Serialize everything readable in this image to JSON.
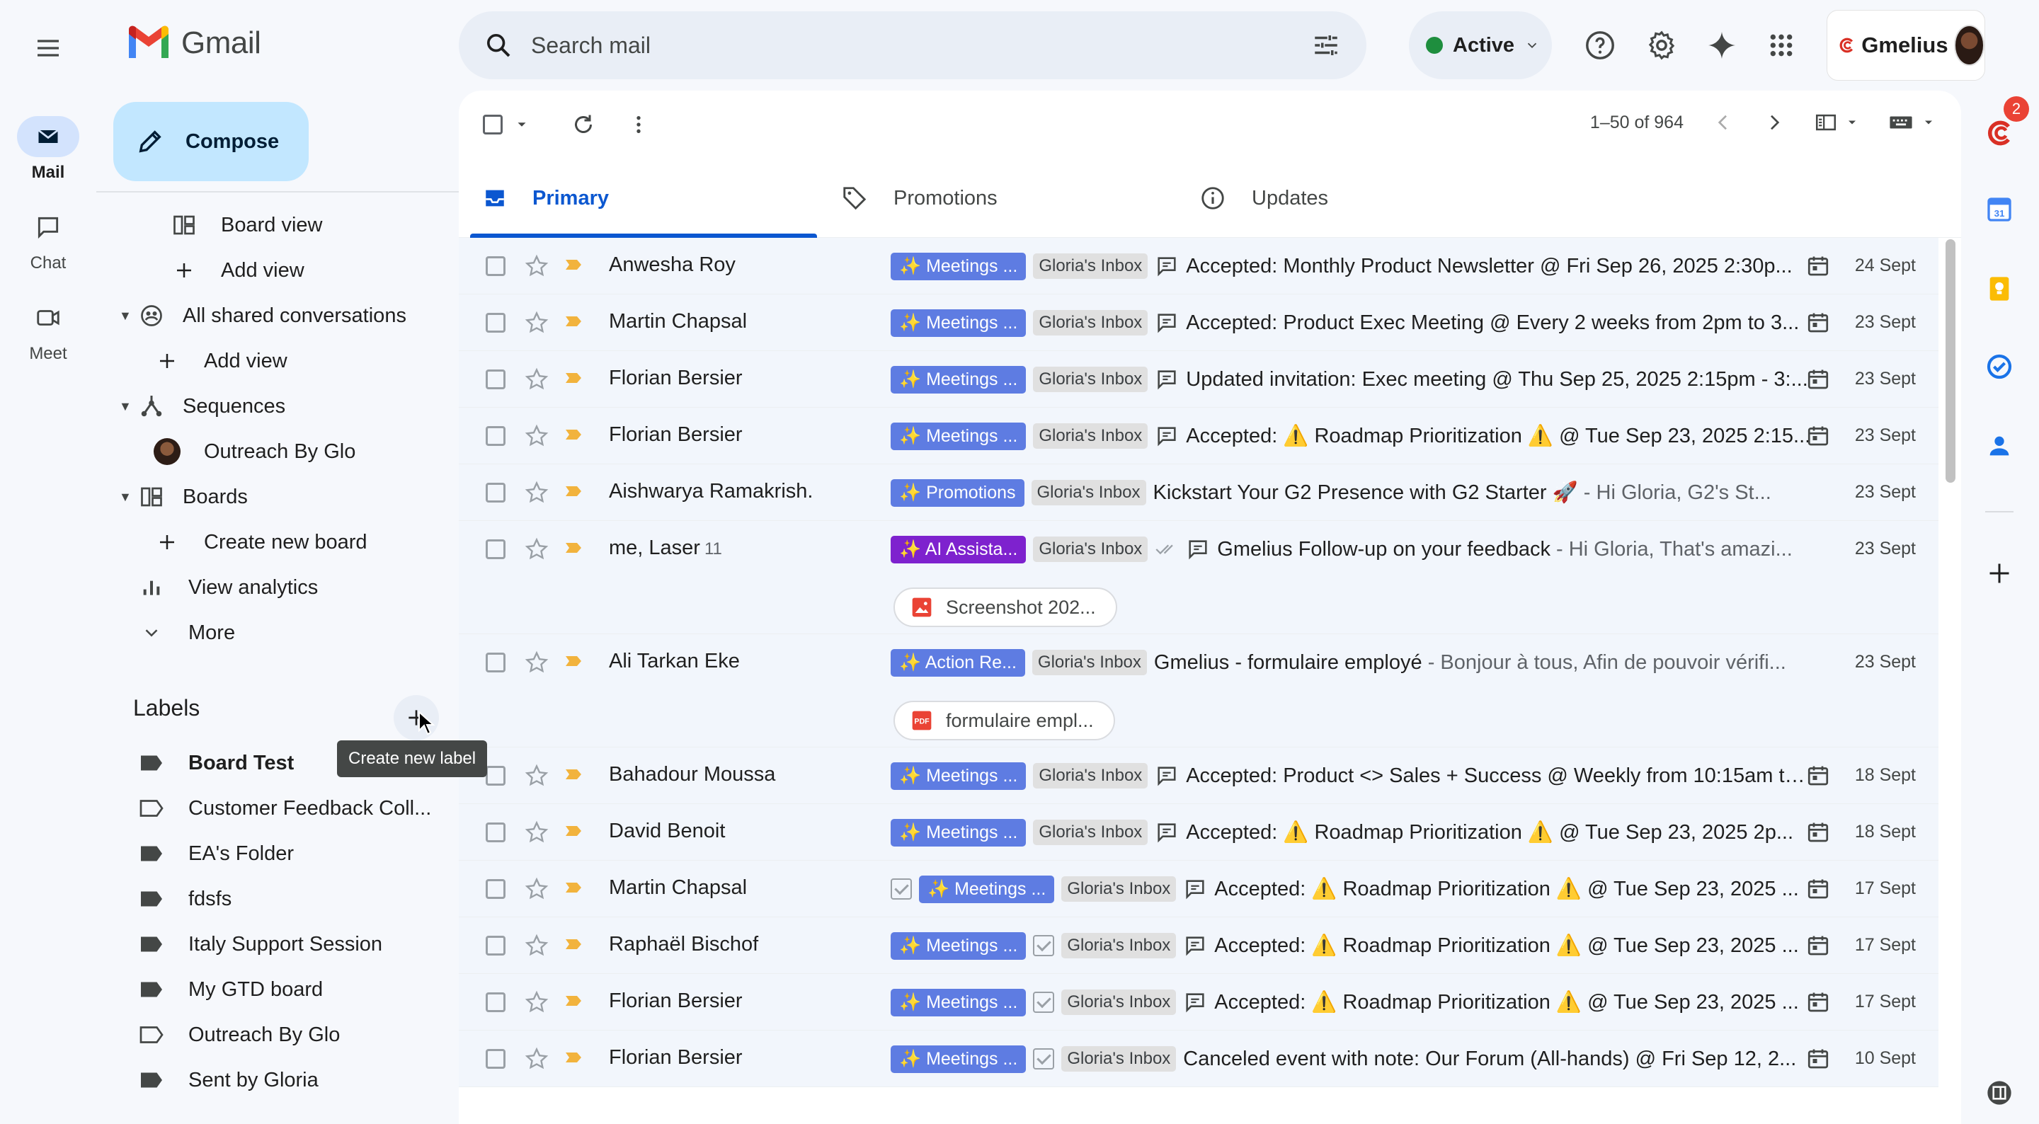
{
  "app": {
    "name": "Gmail"
  },
  "rail": [
    {
      "label": "Mail",
      "icon": "mail-icon",
      "active": true
    },
    {
      "label": "Chat",
      "icon": "chat-icon",
      "active": false
    },
    {
      "label": "Meet",
      "icon": "meet-icon",
      "active": false
    }
  ],
  "search": {
    "placeholder": "Search mail"
  },
  "status": {
    "label": "Active"
  },
  "gmelius": {
    "label": "Gmelius",
    "badge": "2"
  },
  "compose": {
    "label": "Compose"
  },
  "sidebar": {
    "items": [
      {
        "label": "Board view",
        "icon": "board-view-icon"
      },
      {
        "label": "Add view",
        "icon": "plus-icon"
      },
      {
        "label": "All shared conversations",
        "icon": "shared-icon"
      },
      {
        "label": "Add view",
        "icon": "plus-icon"
      },
      {
        "label": "Sequences",
        "icon": "sequences-icon"
      },
      {
        "label": "Outreach By Glo",
        "icon": "avatar"
      },
      {
        "label": "Boards",
        "icon": "boards-icon"
      },
      {
        "label": "Create new board",
        "icon": "plus-icon"
      },
      {
        "label": "View analytics",
        "icon": "analytics-icon"
      },
      {
        "label": "More",
        "icon": "chevron-down-icon"
      }
    ]
  },
  "labels": {
    "title": "Labels",
    "tooltip": "Create new label",
    "items": [
      {
        "label": "Board Test",
        "bold": true,
        "filled": true
      },
      {
        "label": "Customer Feedback Coll...",
        "bold": false,
        "filled": false
      },
      {
        "label": "EA's Folder",
        "bold": false,
        "filled": true
      },
      {
        "label": "fdsfs",
        "bold": false,
        "filled": true
      },
      {
        "label": "Italy Support Session",
        "bold": false,
        "filled": true
      },
      {
        "label": "My GTD board",
        "bold": false,
        "filled": true
      },
      {
        "label": "Outreach By Glo",
        "bold": false,
        "filled": false
      },
      {
        "label": "Sent by Gloria",
        "bold": false,
        "filled": true
      }
    ]
  },
  "toolbar": {
    "range": "1–50 of 964"
  },
  "tabs": [
    {
      "label": "Primary",
      "icon": "inbox-icon",
      "active": true
    },
    {
      "label": "Promotions",
      "icon": "tag-icon",
      "active": false
    },
    {
      "label": "Updates",
      "icon": "info-icon",
      "active": false
    }
  ],
  "emails": [
    {
      "sender": "Anwesha Roy",
      "count": "",
      "chip": "✨ Meetings ...",
      "chip_color": "blue",
      "check_before": false,
      "check_after": false,
      "inbox": "Gloria's Inbox",
      "chat": true,
      "subject": "Accepted: Monthly Product Newsletter @ Fri Sep 26, 2025 2:30p...",
      "snippet": "",
      "cal": true,
      "date": "24 Sept",
      "attachment": ""
    },
    {
      "sender": "Martin Chapsal",
      "count": "",
      "chip": "✨ Meetings ...",
      "chip_color": "blue",
      "check_before": false,
      "check_after": false,
      "inbox": "Gloria's Inbox",
      "chat": true,
      "subject": "Accepted: Product Exec Meeting @ Every 2 weeks from 2pm to 3...",
      "snippet": "",
      "cal": true,
      "date": "23 Sept",
      "attachment": ""
    },
    {
      "sender": "Florian Bersier",
      "count": "",
      "chip": "✨ Meetings ...",
      "chip_color": "blue",
      "check_before": false,
      "check_after": false,
      "inbox": "Gloria's Inbox",
      "chat": true,
      "subject": "Updated invitation: Exec meeting @ Thu Sep 25, 2025 2:15pm - 3:...",
      "snippet": "",
      "cal": true,
      "date": "23 Sept",
      "attachment": ""
    },
    {
      "sender": "Florian Bersier",
      "count": "",
      "chip": "✨ Meetings ...",
      "chip_color": "blue",
      "check_before": false,
      "check_after": false,
      "inbox": "Gloria's Inbox",
      "chat": true,
      "subject": "Accepted: ⚠️ Roadmap Prioritization ⚠️ @ Tue Sep 23, 2025 2:15...",
      "snippet": "",
      "cal": true,
      "date": "23 Sept",
      "attachment": ""
    },
    {
      "sender": "Aishwarya Ramakrish.",
      "count": "",
      "chip": "✨ Promotions",
      "chip_color": "blue",
      "check_before": false,
      "check_after": false,
      "inbox": "Gloria's Inbox",
      "chat": false,
      "subject": "Kickstart Your G2 Presence with G2 Starter 🚀",
      "snippet": " - Hi Gloria, G2's St...",
      "cal": false,
      "date": "23 Sept",
      "attachment": ""
    },
    {
      "sender": "me, Laser",
      "count": "11",
      "chip": "✨ AI Assista...",
      "chip_color": "purple",
      "check_before": false,
      "check_after": false,
      "inbox": "Gloria's Inbox",
      "chat": true,
      "subject": "Gmelius Follow-up on your feedback",
      "snippet": " - Hi Gloria, That's amazi...",
      "cal": false,
      "date": "23 Sept",
      "attachment": "Screenshot 202...",
      "attachment_type": "image"
    },
    {
      "sender": "Ali Tarkan Eke",
      "count": "",
      "chip": "✨ Action Re...",
      "chip_color": "blue",
      "check_before": false,
      "check_after": false,
      "inbox": "Gloria's Inbox",
      "chat": false,
      "subject": "Gmelius - formulaire employé",
      "snippet": " - Bonjour à tous, Afin de pouvoir vérifi...",
      "cal": false,
      "date": "23 Sept",
      "attachment": "formulaire empl...",
      "attachment_type": "pdf"
    },
    {
      "sender": "Bahadour Moussa",
      "count": "",
      "chip": "✨ Meetings ...",
      "chip_color": "blue",
      "check_before": false,
      "check_after": false,
      "inbox": "Gloria's Inbox",
      "chat": true,
      "subject": "Accepted: Product <> Sales + Success @ Weekly from 10:15am to...",
      "snippet": "",
      "cal": true,
      "date": "18 Sept",
      "attachment": ""
    },
    {
      "sender": "David Benoit",
      "count": "",
      "chip": "✨ Meetings ...",
      "chip_color": "blue",
      "check_before": false,
      "check_after": false,
      "inbox": "Gloria's Inbox",
      "chat": true,
      "subject": "Accepted: ⚠️ Roadmap Prioritization ⚠️ @ Tue Sep 23, 2025 2p...",
      "snippet": "",
      "cal": true,
      "date": "18 Sept",
      "attachment": ""
    },
    {
      "sender": "Martin Chapsal",
      "count": "",
      "chip": "✨ Meetings ...",
      "chip_color": "blue",
      "check_before": true,
      "check_after": false,
      "inbox": "Gloria's Inbox",
      "chat": true,
      "subject": "Accepted: ⚠️ Roadmap Prioritization ⚠️ @ Tue Sep 23, 2025 ...",
      "snippet": "",
      "cal": true,
      "date": "17 Sept",
      "attachment": ""
    },
    {
      "sender": "Raphaël Bischof",
      "count": "",
      "chip": "✨ Meetings ...",
      "chip_color": "blue",
      "check_before": false,
      "check_after": true,
      "inbox": "Gloria's Inbox",
      "chat": true,
      "subject": "Accepted: ⚠️ Roadmap Prioritization ⚠️ @ Tue Sep 23, 2025 ...",
      "snippet": "",
      "cal": true,
      "date": "17 Sept",
      "attachment": ""
    },
    {
      "sender": "Florian Bersier",
      "count": "",
      "chip": "✨ Meetings ...",
      "chip_color": "blue",
      "check_before": false,
      "check_after": true,
      "inbox": "Gloria's Inbox",
      "chat": true,
      "subject": "Accepted: ⚠️ Roadmap Prioritization ⚠️ @ Tue Sep 23, 2025 ...",
      "snippet": "",
      "cal": true,
      "date": "17 Sept",
      "attachment": ""
    },
    {
      "sender": "Florian Bersier",
      "count": "",
      "chip": "✨ Meetings ...",
      "chip_color": "blue",
      "check_before": false,
      "check_after": true,
      "inbox": "Gloria's Inbox",
      "chat": false,
      "subject": "Canceled event with note: Our Forum (All-hands) @ Fri Sep 12, 2...",
      "snippet": "",
      "cal": true,
      "date": "10 Sept",
      "attachment": ""
    }
  ],
  "colors": {
    "accent": "#0b57d0",
    "compose_bg": "#c2e7ff",
    "chip_blue": "#5e7ce2",
    "chip_purple": "#7e22ce",
    "important": "#f2b33d",
    "page_bg": "#f6f8fc"
  }
}
